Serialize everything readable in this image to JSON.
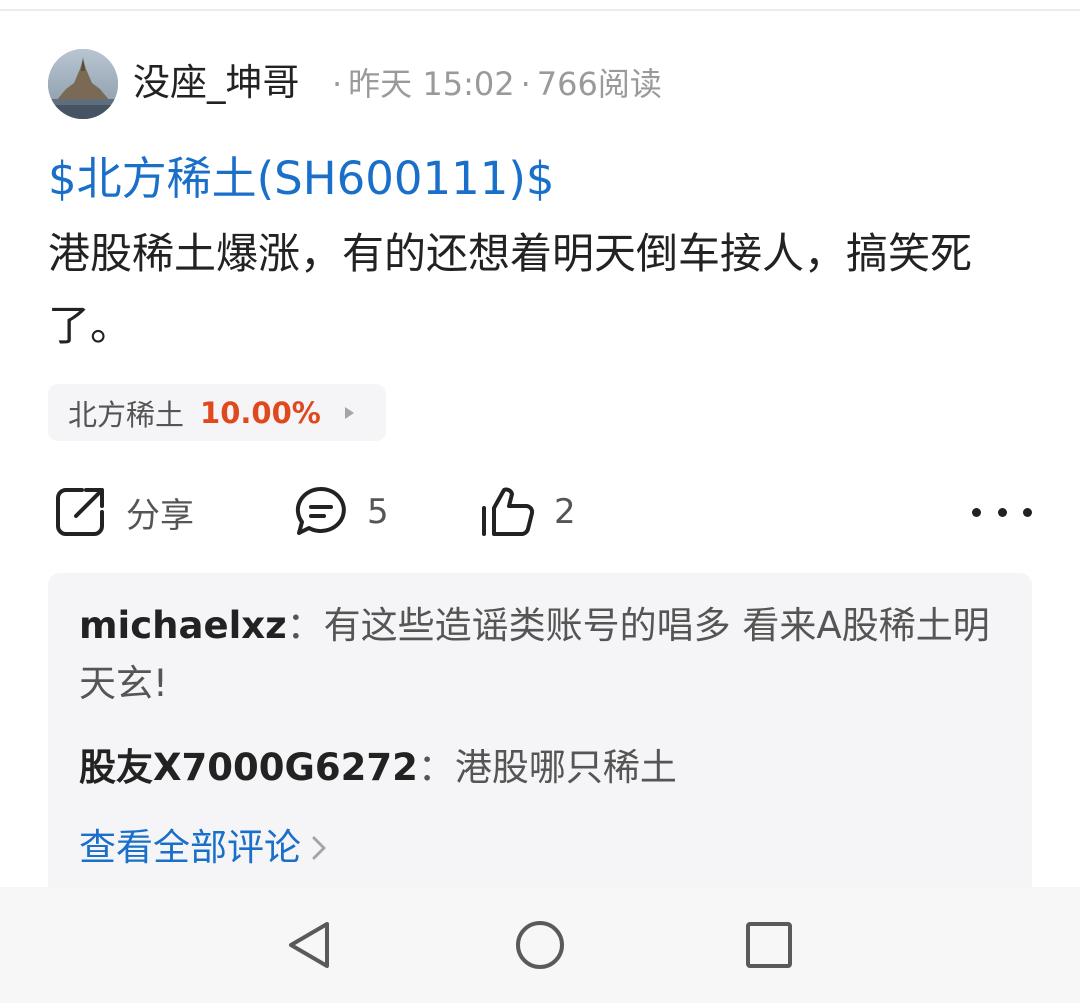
{
  "post": {
    "author": "没座_坤哥",
    "meta_time": "昨天 15:02",
    "meta_reads": "766阅读",
    "stock_link": "$北方稀土(SH600111)$",
    "text": "港股稀土爆涨，有的还想着明天倒车接人，搞笑死了。"
  },
  "stock_chip": {
    "name": "北方稀土",
    "change": "10.00%"
  },
  "actions": {
    "share_label": "分享",
    "comment_count": "5",
    "like_count": "2"
  },
  "comments": [
    {
      "user": "michaelxz",
      "sep": "：",
      "text": "有这些造谣类账号的唱多 看来A股稀土明天玄!"
    },
    {
      "user": "股友X7000G6272",
      "sep": "：",
      "text": "港股哪只稀土"
    }
  ],
  "view_all_label": "查看全部评论",
  "colors": {
    "link_blue": "#1a6fc9",
    "gain_red": "#e0481e",
    "panel_gray": "#f5f5f7"
  },
  "icons": [
    "share-icon",
    "comment-icon",
    "like-icon",
    "more-icon",
    "chevron-right-icon",
    "nav-back-icon",
    "nav-home-icon",
    "nav-recents-icon"
  ]
}
